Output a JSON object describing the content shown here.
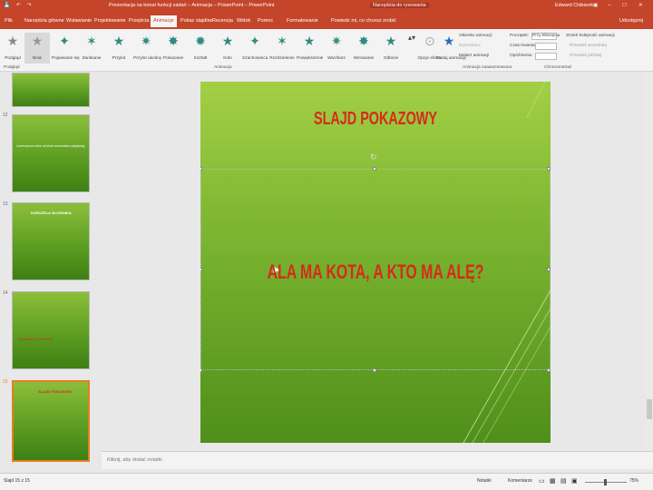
{
  "titlebar": {
    "doc_title": "Prezentacja na temat funkcji zadań – Animacja – PowerPoint – PowerPoint",
    "context_tab": "Narzędzia do rysowania",
    "user": "Edward Chibarek"
  },
  "tabs": [
    "Plik",
    "Narzędzia główne",
    "Wstawianie",
    "Projektowanie",
    "Przejścia",
    "Animacje",
    "Pokaz slajdów",
    "Recenzja",
    "Widok",
    "Pomoc",
    "Formatowanie",
    "Powiedz mi, co chcesz zrobić"
  ],
  "share_label": "Udostępnij",
  "ribbon": {
    "preview_label": "Podgląd",
    "effects": [
      "Brak",
      "Pojawianie się",
      "Zanikanie",
      "Przylot",
      "Przylot ukośny",
      "Pokazanie",
      "Kształt",
      "Koło",
      "Szachownica",
      "Rozdzielenie",
      "Powiększenie",
      "Wachlarz",
      "Wirowanie",
      "Odbicie"
    ],
    "effect_options_label": "Opcje efektu",
    "add_animation_label": "Dodaj animację",
    "animation_pane": "Okienko animacji",
    "trigger": "Wyzwalacz",
    "painter": "Malarz animacji",
    "start_label": "Początek:",
    "start_value": "Przy kliknięciu",
    "duration_label": "Czas trwania:",
    "delay_label": "Opóźnienie:",
    "reorder": "Zmień kolejność animacji",
    "move_earlier": "Przenieś wcześniej",
    "move_later": "Przenieś później",
    "groups": [
      "Podgląd",
      "Animacja",
      "Animacja zaawansowana",
      "Chronometraż"
    ]
  },
  "thumbnails": [
    {
      "num": "",
      "title": ""
    },
    {
      "num": "12",
      "title": "Lorem ipsum dolor sit amet consectetur adipiscing"
    },
    {
      "num": "13",
      "title": "KARUZELA SŁOWNIKA"
    },
    {
      "num": "14",
      "title": "Informacje o prezentacji"
    },
    {
      "num": "15",
      "title": "SLAJD POKAZOWY"
    }
  ],
  "slide": {
    "title": "SLAJD POKAZOWY",
    "body": "ALA MA KOTA, A KTO MA ALĘ?"
  },
  "notes_placeholder": "Kliknij, aby dodać notatki",
  "status": {
    "slide_counter": "Slajd 15 z 15",
    "notes": "Notatki",
    "comments": "Komentarze",
    "zoom": "75%"
  },
  "colors": {
    "accent": "#c4452a",
    "slide_title": "#d62b1a",
    "slide_bg": "#79b32f"
  }
}
